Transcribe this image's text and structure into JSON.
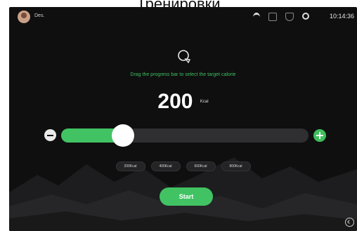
{
  "caption": "Тренировки",
  "status_bar": {
    "username": "Des.",
    "time": "10:14:36",
    "icons": [
      "wifi-icon",
      "bluetooth-icon",
      "shield-icon",
      "gear-icon"
    ]
  },
  "main": {
    "prompt": "Drag the progress bar to select the target calorie",
    "value": "200",
    "unit": "Kcal",
    "slider": {
      "min": 0,
      "max": 1000,
      "value": 200,
      "fraction": 0.25
    },
    "presets": [
      "200Kcal",
      "400Kcal",
      "600Kcal",
      "800Kcal"
    ],
    "start_label": "Start"
  },
  "colors": {
    "accent": "#41c363",
    "background": "#0f0f10",
    "track": "#2f2f31"
  }
}
